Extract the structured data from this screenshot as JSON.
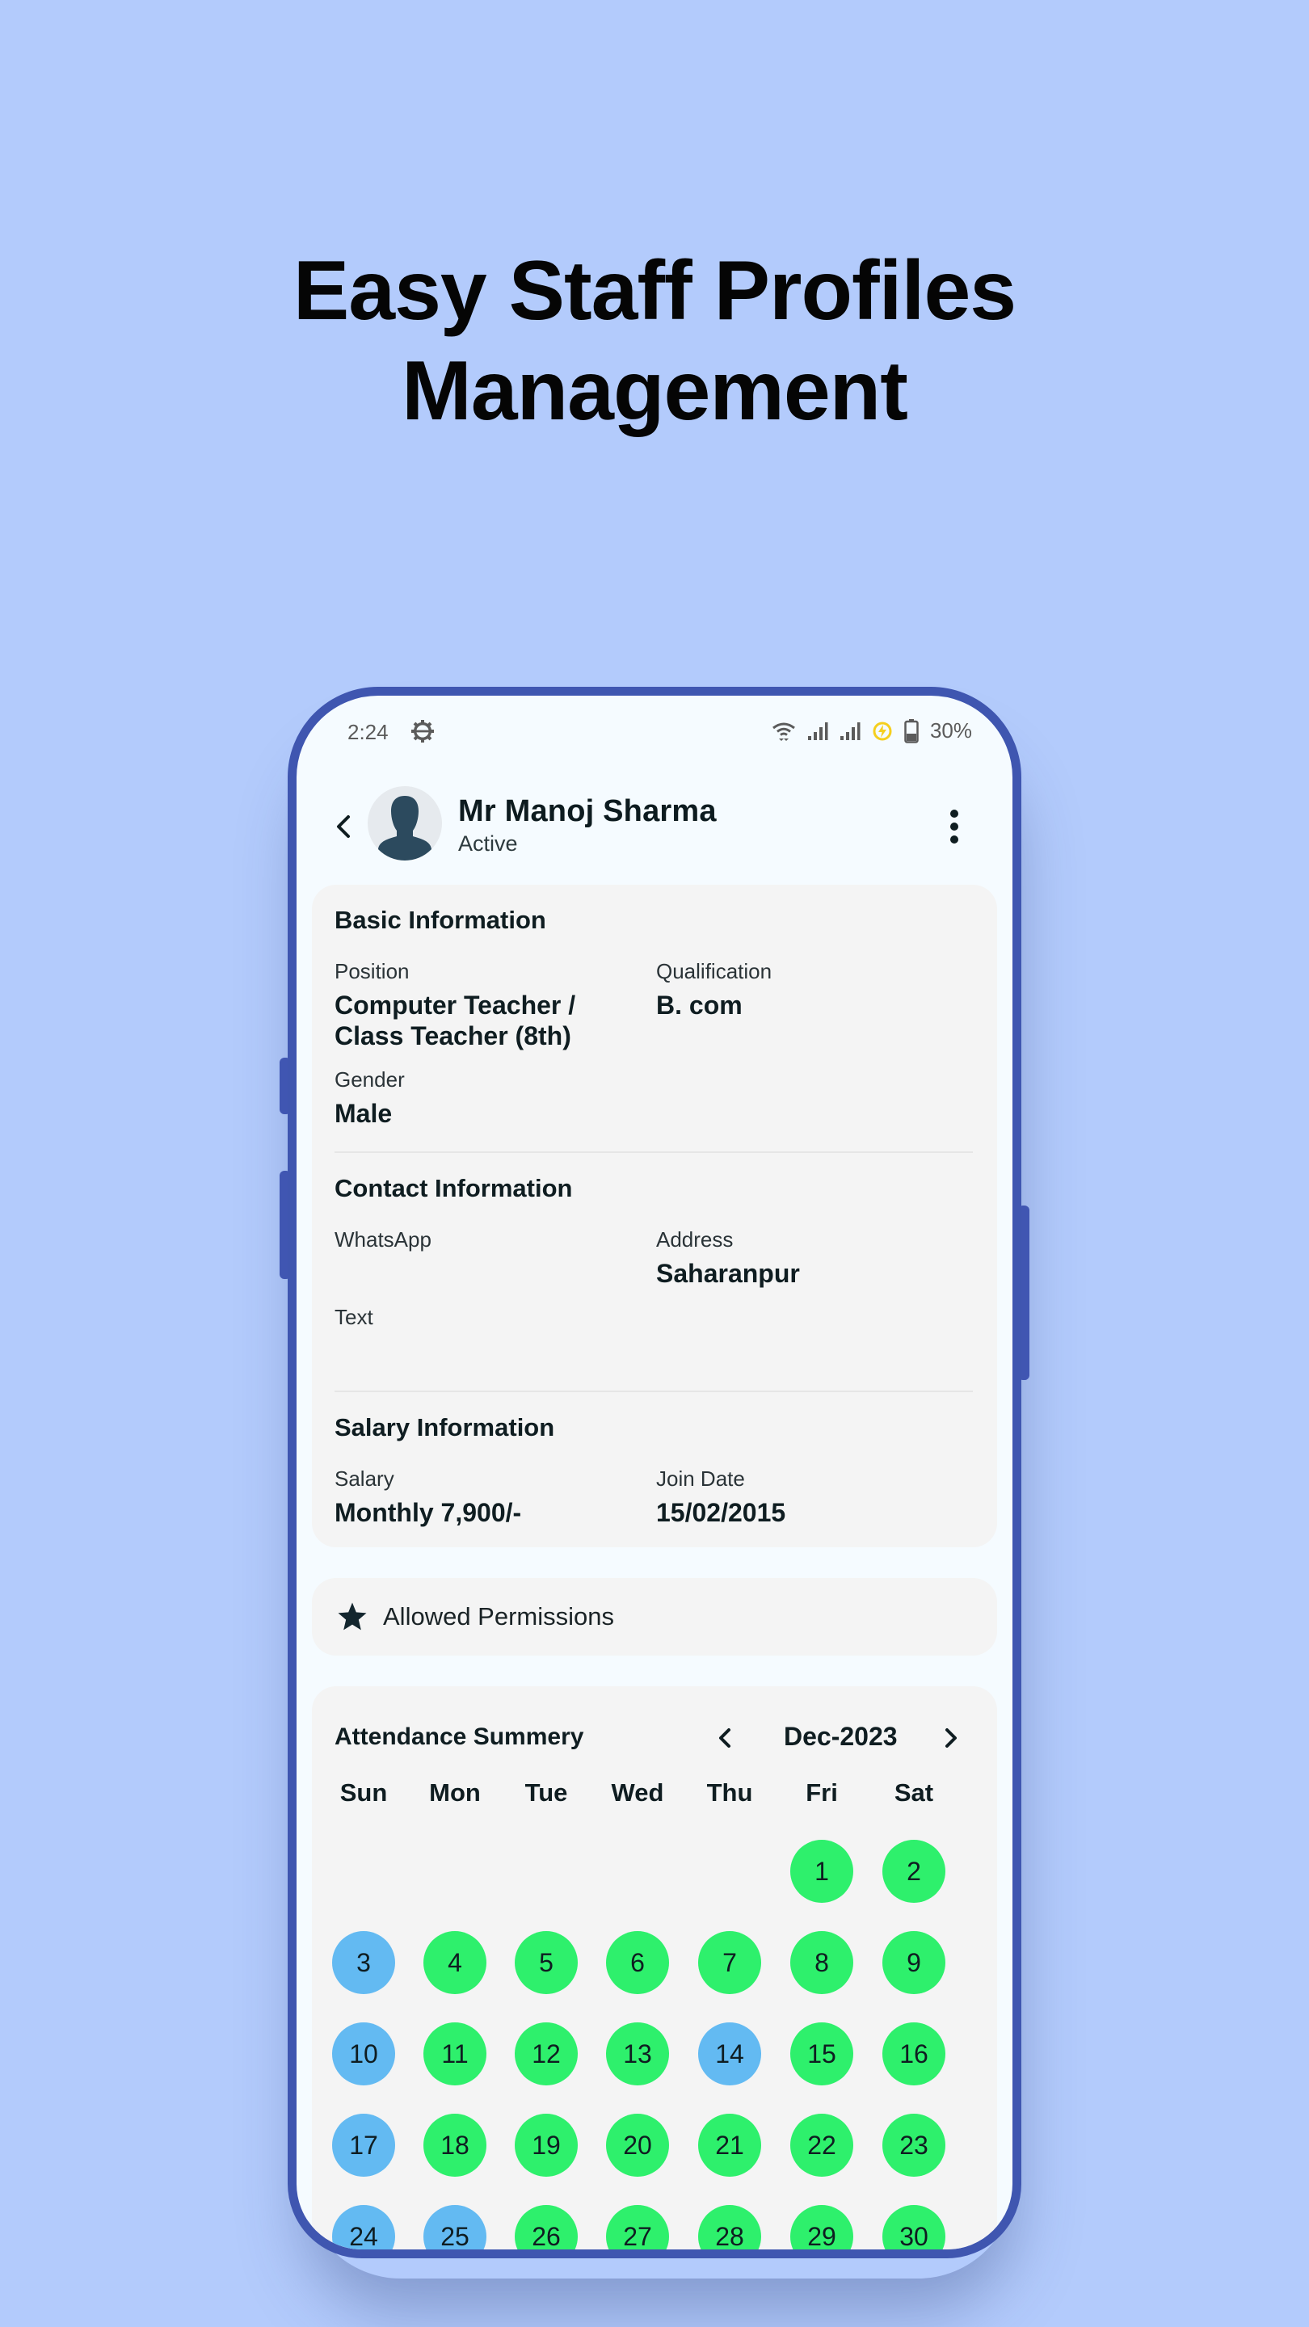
{
  "headline": {
    "line1": "Easy Staff Profiles",
    "line2": "Management"
  },
  "statusbar": {
    "time": "2:24",
    "battery": "30%",
    "icons": [
      "gear-icon",
      "wifi-icon",
      "signal-icon",
      "signal-icon",
      "power-saving-icon",
      "battery-icon"
    ]
  },
  "appbar": {
    "name": "Mr Manoj Sharma",
    "status": "Active"
  },
  "basic": {
    "title": "Basic Information",
    "position_label": "Position",
    "position_value": "Computer Teacher / Class Teacher (8th)",
    "position_line1": "Computer Teacher /",
    "position_line2": "Class Teacher (8th)",
    "qualification_label": "Qualification",
    "qualification_value": "B. com",
    "gender_label": "Gender",
    "gender_value": "Male"
  },
  "contact": {
    "title": "Contact Information",
    "whatsapp_label": "WhatsApp",
    "whatsapp_value": "",
    "address_label": "Address",
    "address_value": "Saharanpur",
    "text_label": "Text",
    "text_value": ""
  },
  "salary": {
    "title": "Salary Information",
    "salary_label": "Salary",
    "salary_value": "Monthly 7,900/-",
    "join_label": "Join Date",
    "join_value": "15/02/2015"
  },
  "permissions": {
    "label": "Allowed Permissions"
  },
  "attendance": {
    "title": "Attendance Summery",
    "month": "Dec-2023",
    "weekdays": [
      "Sun",
      "Mon",
      "Tue",
      "Wed",
      "Thu",
      "Fri",
      "Sat"
    ],
    "first_weekday_index": 5,
    "colors": {
      "present": "#2ef06c",
      "holiday": "#63baf2"
    },
    "days": [
      {
        "d": "1",
        "s": "present"
      },
      {
        "d": "2",
        "s": "present"
      },
      {
        "d": "3",
        "s": "holiday"
      },
      {
        "d": "4",
        "s": "present"
      },
      {
        "d": "5",
        "s": "present"
      },
      {
        "d": "6",
        "s": "present"
      },
      {
        "d": "7",
        "s": "present"
      },
      {
        "d": "8",
        "s": "present"
      },
      {
        "d": "9",
        "s": "present"
      },
      {
        "d": "10",
        "s": "holiday"
      },
      {
        "d": "11",
        "s": "present"
      },
      {
        "d": "12",
        "s": "present"
      },
      {
        "d": "13",
        "s": "present"
      },
      {
        "d": "14",
        "s": "holiday"
      },
      {
        "d": "15",
        "s": "present"
      },
      {
        "d": "16",
        "s": "present"
      },
      {
        "d": "17",
        "s": "holiday"
      },
      {
        "d": "18",
        "s": "present"
      },
      {
        "d": "19",
        "s": "present"
      },
      {
        "d": "20",
        "s": "present"
      },
      {
        "d": "21",
        "s": "present"
      },
      {
        "d": "22",
        "s": "present"
      },
      {
        "d": "23",
        "s": "present"
      },
      {
        "d": "24",
        "s": "holiday"
      },
      {
        "d": "25",
        "s": "holiday"
      },
      {
        "d": "26",
        "s": "present"
      },
      {
        "d": "27",
        "s": "present"
      },
      {
        "d": "28",
        "s": "present"
      },
      {
        "d": "29",
        "s": "present"
      },
      {
        "d": "30",
        "s": "present"
      }
    ]
  }
}
